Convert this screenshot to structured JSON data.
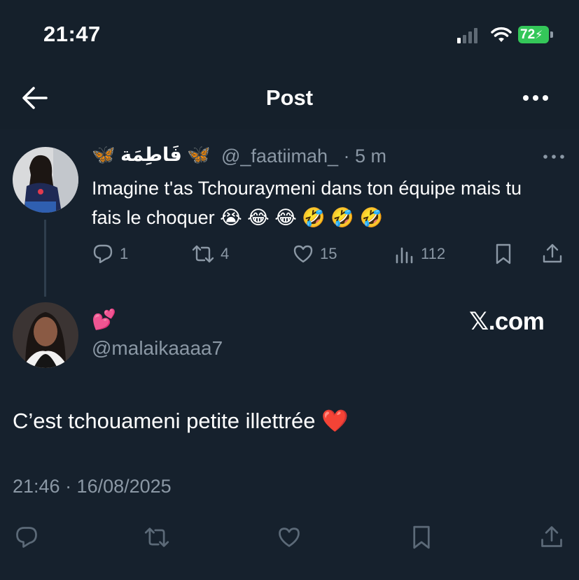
{
  "status_bar": {
    "time": "21:47",
    "battery": "72"
  },
  "header": {
    "title": "Post"
  },
  "colors": {
    "background": "#15202b",
    "muted": "#8b98a5",
    "battery_green": "#34c759",
    "heart_red": "#e0245e"
  },
  "quoted_post": {
    "display_name": "🦋 فَاطِمَة 🦋",
    "handle_time": "@_faatiimah_ · 5 m",
    "text": "Imagine t'as Tchouraymeni dans ton équipe mais tu fais le choquer 😭 😂 😂 🤣 🤣 🤣",
    "replies": "1",
    "reposts": "4",
    "likes": "15",
    "views": "112"
  },
  "reply_post": {
    "display_name": "💕",
    "handle": "@malaikaaaa7",
    "watermark": "𝕏.com",
    "text": "C’est tchouameni petite illettrée ❤️",
    "timestamp": "21:46 · 16/08/2025"
  },
  "icons": [
    "back-arrow-icon",
    "more-horizontal-icon",
    "reply-icon",
    "repost-icon",
    "like-icon",
    "views-icon",
    "bookmark-icon",
    "share-icon"
  ]
}
